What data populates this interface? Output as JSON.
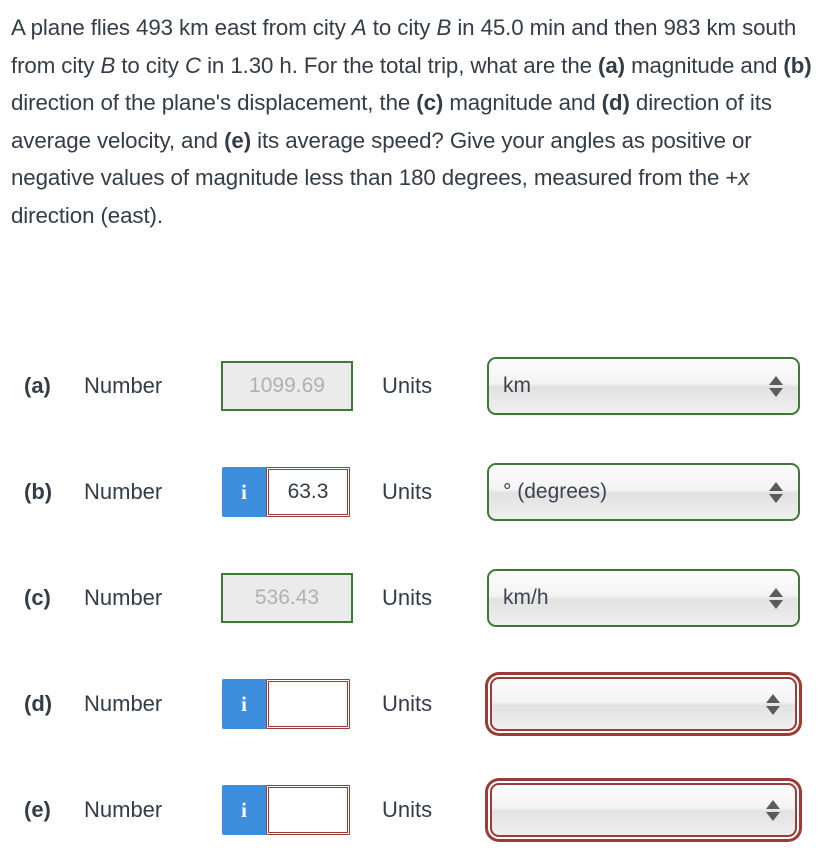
{
  "question": {
    "segments": [
      {
        "t": "A plane flies 493 km east from city ",
        "style": "normal"
      },
      {
        "t": "A",
        "style": "italic"
      },
      {
        "t": " to city ",
        "style": "normal"
      },
      {
        "t": "B",
        "style": "italic"
      },
      {
        "t": " in 45.0 min and then 983 km south from city ",
        "style": "normal"
      },
      {
        "t": "B",
        "style": "italic"
      },
      {
        "t": " to city ",
        "style": "normal"
      },
      {
        "t": "C",
        "style": "italic"
      },
      {
        "t": " in 1.30 h. For the total trip, what are the ",
        "style": "normal"
      },
      {
        "t": "(a)",
        "style": "bold"
      },
      {
        "t": " magnitude and ",
        "style": "normal"
      },
      {
        "t": "(b)",
        "style": "bold"
      },
      {
        "t": " direction of the plane's displacement, the ",
        "style": "normal"
      },
      {
        "t": "(c)",
        "style": "bold"
      },
      {
        "t": " magnitude and ",
        "style": "normal"
      },
      {
        "t": "(d)",
        "style": "bold"
      },
      {
        "t": " direction of its average velocity, and ",
        "style": "normal"
      },
      {
        "t": "(e)",
        "style": "bold"
      },
      {
        "t": " its average speed? Give your angles as positive or negative values of magnitude less than 180 degrees, measured from the +",
        "style": "normal"
      },
      {
        "t": "x",
        "style": "italic"
      },
      {
        "t": " direction (east).",
        "style": "normal"
      }
    ],
    "plain": "A plane flies 493 km east from city A to city B in 45.0 min and then 983 km south from city B to city C in 1.30 h. For the total trip, what are the (a) magnitude and (b) direction of the plane's displacement, the (c) magnitude and (d) direction of its average velocity, and (e) its average speed? Give your angles as positive or negative values of magnitude less than 180 degrees, measured from the +x direction (east)."
  },
  "labels": {
    "number": "Number",
    "units": "Units",
    "info_icon": "i"
  },
  "colors": {
    "correct_border": "#3d7a36",
    "flagged_border": "#9c3c36",
    "info_button": "#3e8ede",
    "text": "#333c47",
    "disabled_value": "#aeb1b4",
    "disabled_field_bg": "#ebebeb"
  },
  "rows": [
    {
      "part": "(a)",
      "number_label": "Number",
      "units_label": "Units",
      "has_info_button": false,
      "value": "1099.69",
      "value_state": "correct",
      "unit_value": "km",
      "unit_state": "ok"
    },
    {
      "part": "(b)",
      "number_label": "Number",
      "units_label": "Units",
      "has_info_button": true,
      "value": "63.3",
      "value_state": "flagged",
      "unit_value": "° (degrees)",
      "unit_state": "ok"
    },
    {
      "part": "(c)",
      "number_label": "Number",
      "units_label": "Units",
      "has_info_button": false,
      "value": "536.43",
      "value_state": "correct",
      "unit_value": "km/h",
      "unit_state": "ok"
    },
    {
      "part": "(d)",
      "number_label": "Number",
      "units_label": "Units",
      "has_info_button": true,
      "value": "",
      "value_state": "flagged",
      "unit_value": "",
      "unit_state": "flagged"
    },
    {
      "part": "(e)",
      "number_label": "Number",
      "units_label": "Units",
      "has_info_button": true,
      "value": "",
      "value_state": "flagged",
      "unit_value": "",
      "unit_state": "flagged"
    }
  ]
}
